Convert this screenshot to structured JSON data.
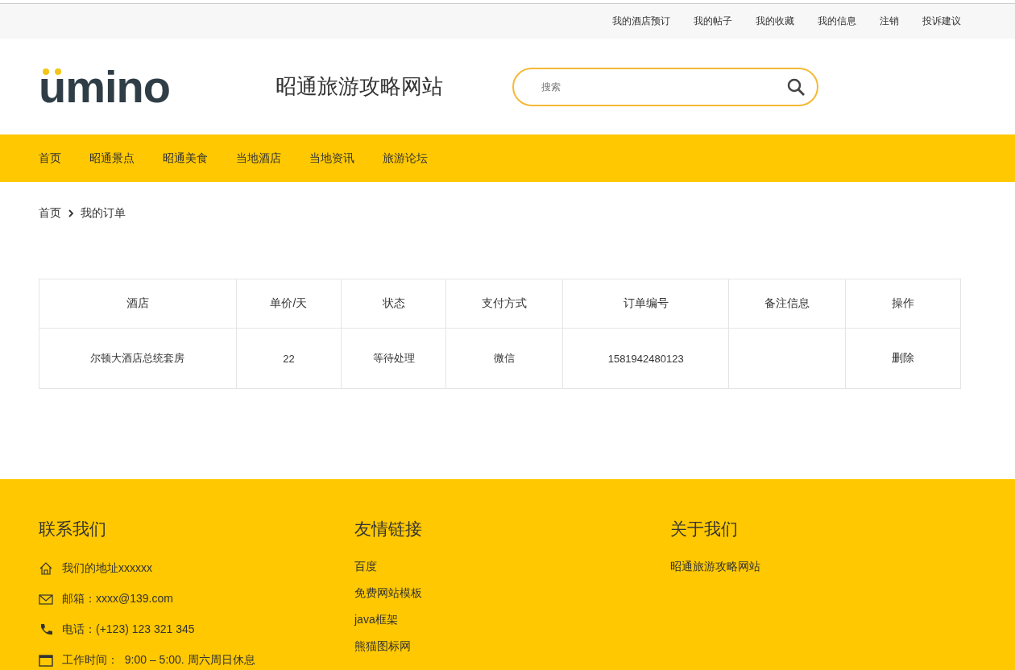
{
  "top_links": [
    "我的酒店预订",
    "我的帖子",
    "我的收藏",
    "我的信息",
    "注销",
    "投诉建议"
  ],
  "header": {
    "logo": "umino",
    "site_title": "昭通旅游攻略网站",
    "search": {
      "placeholder": "搜索"
    }
  },
  "nav": [
    {
      "label": "首页"
    },
    {
      "label": "昭通景点"
    },
    {
      "label": "昭通美食"
    },
    {
      "label": "当地酒店"
    },
    {
      "label": "当地资讯"
    },
    {
      "label": "旅游论坛"
    }
  ],
  "breadcrumb": {
    "home": "首页",
    "current": "我的订单"
  },
  "table": {
    "columns": [
      "酒店",
      "单价/天",
      "状态",
      "支付方式",
      "订单编号",
      "备注信息",
      "操作"
    ],
    "rows": [
      {
        "hotel": "尔顿大酒店总统套房",
        "price": "22",
        "status": "等待处理",
        "payment": "微信",
        "order_no": "1581942480123",
        "note": "",
        "action": "删除"
      }
    ]
  },
  "footer": {
    "contact": {
      "title": "联系我们",
      "items": [
        {
          "kind": "address",
          "text": "我们的地址xxxxxx"
        },
        {
          "kind": "email",
          "text": "邮箱：xxxx@139.com"
        },
        {
          "kind": "phone",
          "text": "电话：(+123) 123 321 345"
        },
        {
          "kind": "hours",
          "text": "工作时间：  9:00 – 5:00. 周六周日休息"
        }
      ]
    },
    "links": {
      "title": "友情链接",
      "items": [
        "百度",
        "免费网站模板",
        "java框架",
        "熊猫图标网"
      ]
    },
    "about": {
      "title": "关于我们",
      "items": [
        "昭通旅游攻略网站"
      ]
    }
  }
}
